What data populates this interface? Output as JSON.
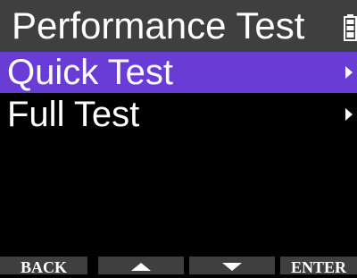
{
  "header": {
    "title": "Performance Test",
    "battery_icon": "battery-icon"
  },
  "menu": {
    "items": [
      {
        "label": "Quick Test",
        "selected": true,
        "icon": "chevron-right-icon"
      },
      {
        "label": "Full Test",
        "selected": false,
        "icon": "chevron-right-icon"
      }
    ]
  },
  "softkeys": {
    "back": "BACK",
    "up_icon": "arrow-up-icon",
    "down_icon": "arrow-down-icon",
    "enter": "ENTER"
  },
  "colors": {
    "background": "#000000",
    "bar": "#3f3f3f",
    "selection": "#6a3cd6",
    "text": "#ffffff"
  }
}
